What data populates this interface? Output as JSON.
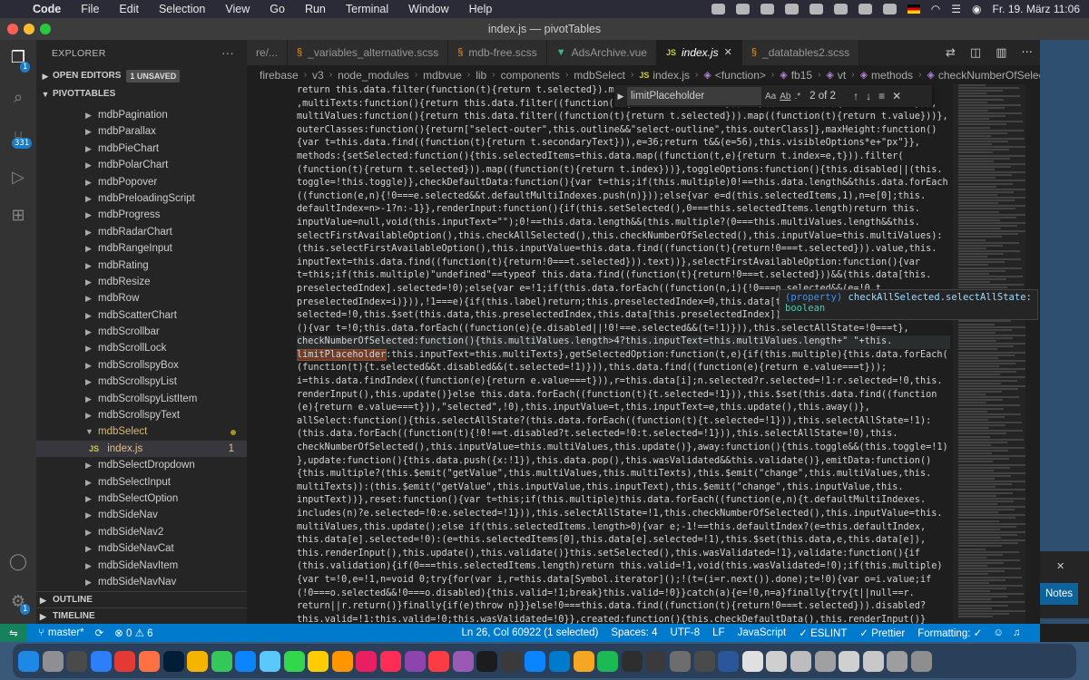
{
  "menubar": {
    "app": "Code",
    "items": [
      "File",
      "Edit",
      "Selection",
      "View",
      "Go",
      "Run",
      "Terminal",
      "Window",
      "Help"
    ],
    "clock": "Fr. 19. März  11:06"
  },
  "window": {
    "title": "index.js — pivotTables"
  },
  "activity": {
    "ext_badge": "331",
    "manage_badge": "1",
    "explorer_badge": "1"
  },
  "sidebar": {
    "title": "EXPLORER",
    "open_editors": "OPEN EDITORS",
    "unsaved": "1 UNSAVED",
    "project": "PIVOTTABLES",
    "items": [
      "mdbPagination",
      "mdbParallax",
      "mdbPieChart",
      "mdbPolarChart",
      "mdbPopover",
      "mdbPreloadingScript",
      "mdbProgress",
      "mdbRadarChart",
      "mdbRangeInput",
      "mdbRating",
      "mdbResize",
      "mdbRow",
      "mdbScatterChart",
      "mdbScrollbar",
      "mdbScrollLock",
      "mdbScrollspyBox",
      "mdbScrollspyList",
      "mdbScrollspyListItem",
      "mdbScrollspyText"
    ],
    "open_folder": "mdbSelect",
    "open_file_icon": "JS",
    "open_file": "index.js",
    "open_file_count": "1",
    "items_after": [
      "mdbSelectDropdown",
      "mdbSelectInput",
      "mdbSelectOption",
      "mdbSideNav",
      "mdbSideNav2",
      "mdbSideNavCat",
      "mdbSideNavItem",
      "mdbSideNavNav"
    ],
    "outline": "OUTLINE",
    "timeline": "TIMELINE"
  },
  "tabs": [
    {
      "label": "re/...",
      "icon": ""
    },
    {
      "label": "_variables_alternative.scss",
      "icon": "scss"
    },
    {
      "label": "mdb-free.scss",
      "icon": "scss"
    },
    {
      "label": "AdsArchive.vue",
      "icon": "vue"
    },
    {
      "label": "index.js",
      "icon": "js",
      "active": true
    },
    {
      "label": "_datatables2.scss",
      "icon": "scss"
    }
  ],
  "breadcrumb": [
    "firebase",
    "v3",
    "node_modules",
    "mdbvue",
    "lib",
    "components",
    "mdbSelect",
    "index.js",
    "<function>",
    "fb15",
    "vt",
    "methods",
    "checkNumberOfSelected"
  ],
  "find": {
    "query": "limitPlaceholder",
    "count": "2 of 2",
    "aa": "Aa",
    "ab": "Ab",
    "re": ".*"
  },
  "hover": {
    "kind": "(property)",
    "name": "checkAllSelected.selectAllState:",
    "type": "boolean"
  },
  "code_lines": [
    "return this.data.filter(function(t){return t.selected}).map(function(t){return t.text}),",
    ",multiTexts:function(){return this.data.filter((function(t){return t.selected})).map((function(t){return t.text})),",
    "multiValues:function(){return this.data.filter((function(t){return t.selected})).map((function(t){return t.value}))},",
    "outerClasses:function(){return[\"select-outer\",this.outline&&\"select-outline\",this.outerClass]},maxHeight:function()",
    "{var t=this.data.find((function(t){return t.secondaryText})),e=36;return t&&(e=56),this.visibleOptions*e+\"px\"}},",
    "methods:{setSelected:function(){this.selectedItems=this.data.map((function(t,e){return t.index=e,t})).filter(",
    "(function(t){return t.selected})).map((function(t){return t.index}))},toggleOptions:function(){this.disabled||(this.",
    "toggle=!this.toggle)},checkDefaultData:function(){var t=this;if(this.multiple)0!==this.data.length&&this.data.forEach",
    "((function(e,n){!0===e.selected&&t.defaultMultiIndexes.push(n)}));else{var e=d(this.selectedItems,1),n=e[0];this.",
    "defaultIndex=n>-1?n:-1}},renderInput:function(){if(this.setSelected(),0===this.selectedItems.length)return this.",
    "inputValue=null,void(this.inputText=\"\");0!==this.data.length&&(this.multiple?(0===this.multiValues.length&&this.",
    "selectFirstAvailableOption(),this.checkAllSelected(),this.checkNumberOfSelected(),this.inputValue=this.multiValues):",
    "(this.selectFirstAvailableOption(),this.inputValue=this.data.find((function(t){return!0===t.selected})).value,this.",
    "inputText=this.data.find((function(t){return!0===t.selected})).text))},selectFirstAvailableOption:function(){var",
    "t=this;if(this.multiple)\"undefined\"==typeof this.data.find((function(t){return!0===t.selected}))&&(this.data[this.",
    "preselectedIndex].selected=!0);else{var e=!1;if(this.data.forEach((function(n,i){!0===n.selected&&(e=!0,t.",
    "preselectedIndex=i)})),!1===e){if(this.label)return;this.preselectedIndex=0,this.data[t",
    "selected=!0,this.$set(this.data,this.preselectedIndex,this.data[this.preselectedIndex]),",
    "(){var t=!0;this.data.forEach((function(e){e.disabled||!0!==e.selected&&(t=!1)})),this.selectAllState=!0===t},",
    "checkNumberOfSelected:function(){this.multiValues.length>4?this.inputText=this.multiValues.length+\" \"+this.",
    "limitPlaceholder:this.inputText=this.multiTexts},getSelectedOption:function(t,e){if(this.multiple){this.data.forEach(",
    "(function(t){t.selected&&t.disabled&&(t.selected=!1)})),this.data.find((function(e){return e.value===t}));",
    "i=this.data.findIndex((function(e){return e.value===t})),r=this.data[i];n.selected?r.selected=!1:r.selected=!0,this.",
    "renderInput(),this.update()}else this.data.forEach((function(t){t.selected=!1})),this.$set(this.data.find((function",
    "(e){return e.value===t})),\"selected\",!0),this.inputValue=t,this.inputText=e,this.update(),this.away()},",
    "allSelect:function(){this.selectAllState?(this.data.forEach((function(t){t.selected=!1})),this.selectAllState=!1):",
    "(this.data.forEach((function(t){!0!==t.disabled?t.selected=!0:t.selected=!1})),this.selectAllState=!0),this.",
    "checkNumberOfSelected(),this.inputValue=this.multiValues,this.update()},away:function(){this.toggle&&(this.toggle=!1)",
    "},update:function(){this.data.push({x:!1}),this.data.pop(),this.wasValidated&&this.validate()},emitData:function()",
    "{this.multiple?(this.$emit(\"getValue\",this.multiValues,this.multiTexts),this.$emit(\"change\",this.multiValues,this.",
    "multiTexts)):(this.$emit(\"getValue\",this.inputValue,this.inputText),this.$emit(\"change\",this.inputValue,this.",
    "inputText))},reset:function(){var t=this;if(this.multiple)this.data.forEach((function(e,n){t.defaultMultiIndexes.",
    "includes(n)?e.selected=!0:e.selected=!1})),this.selectAllState=!1,this.checkNumberOfSelected(),this.inputValue=this.",
    "multiValues,this.update();else if(this.selectedItems.length>0){var e;-1!==this.defaultIndex?(e=this.defaultIndex,",
    "this.data[e].selected=!0):(e=this.selectedItems[0],this.data[e].selected=!1),this.$set(this.data,e,this.data[e]),",
    "this.renderInput(),this.update(),this.validate()}this.setSelected(),this.wasValidated=!1},validate:function(){if",
    "(this.validation){if(0===this.selectedItems.length)return this.valid=!1,void(this.wasValidated=!0);if(this.multiple)",
    "{var t=!0,e=!1,n=void 0;try{for(var i,r=this.data[Symbol.iterator]();!(t=(i=r.next()).done);t=!0){var o=i.value;if",
    "(!0===o.selected&&!0===o.disabled){this.valid=!1;break}this.valid=!0}}catch(a){e=!0,n=a}finally{try{t||null==r.",
    "return||r.return()}finally{if(e)throw n}}}else!0===this.data.find((function(t){return!0===t.selected})).disabled?",
    "this.valid=!1:this.valid=!0;this.wasValidated=!0}},created:function(){this.checkDefaultData(),this.renderInput()}"
  ],
  "status": {
    "branch": "master*",
    "problems": "⊗ 0 ⚠ 6",
    "position": "Ln 26, Col 60922 (1 selected)",
    "spaces": "Spaces: 4",
    "encoding": "UTF-8",
    "eol": "LF",
    "language": "JavaScript",
    "eslint": "✓ ESLINT",
    "prettier": "✓ Prettier",
    "formatting": "Formatting: ✓"
  },
  "notification": {
    "button": "Notes"
  },
  "colors": {
    "accent": "#007acc",
    "folder": "#d7ba7d",
    "match": "#6e3e2a"
  }
}
